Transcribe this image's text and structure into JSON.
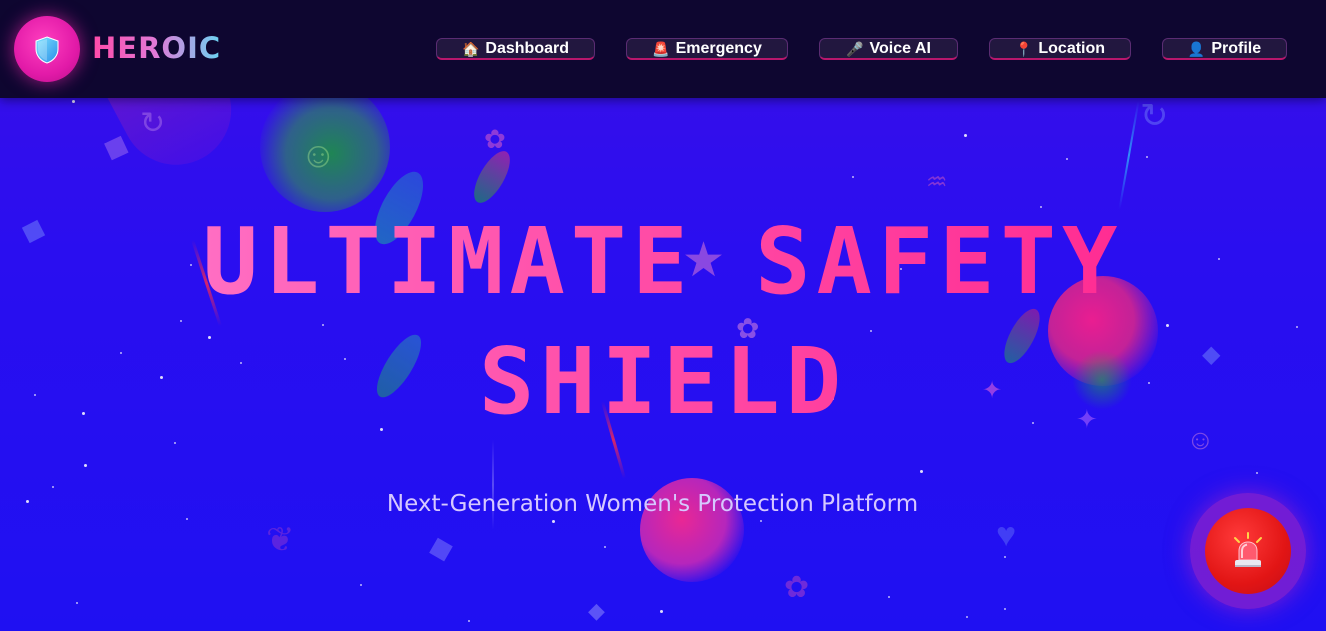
{
  "header": {
    "logo_icon": "shield-icon",
    "brand": "HEROIC",
    "nav": [
      {
        "icon": "house-icon",
        "glyph": "🏠",
        "label": "Dashboard"
      },
      {
        "icon": "siren-icon",
        "glyph": "🚨",
        "label": "Emergency"
      },
      {
        "icon": "microphone-icon",
        "glyph": "🎤",
        "label": "Voice AI"
      },
      {
        "icon": "map-pin-icon",
        "glyph": "📍",
        "label": "Location"
      },
      {
        "icon": "user-icon",
        "glyph": "👤",
        "label": "Profile"
      }
    ]
  },
  "hero": {
    "title_line_1": "ULTIMATE SAFETY",
    "title_line_2": "SHIELD",
    "subtitle": "Next-Generation Women's Protection Platform"
  },
  "sos_button": {
    "icon": "siren-icon"
  },
  "colors": {
    "background": "#2a0ef0",
    "header": "#0e0630",
    "accent_pink": "#ff2f93",
    "accent_cyan": "#6ad4f2",
    "sos_red": "#e21515"
  }
}
